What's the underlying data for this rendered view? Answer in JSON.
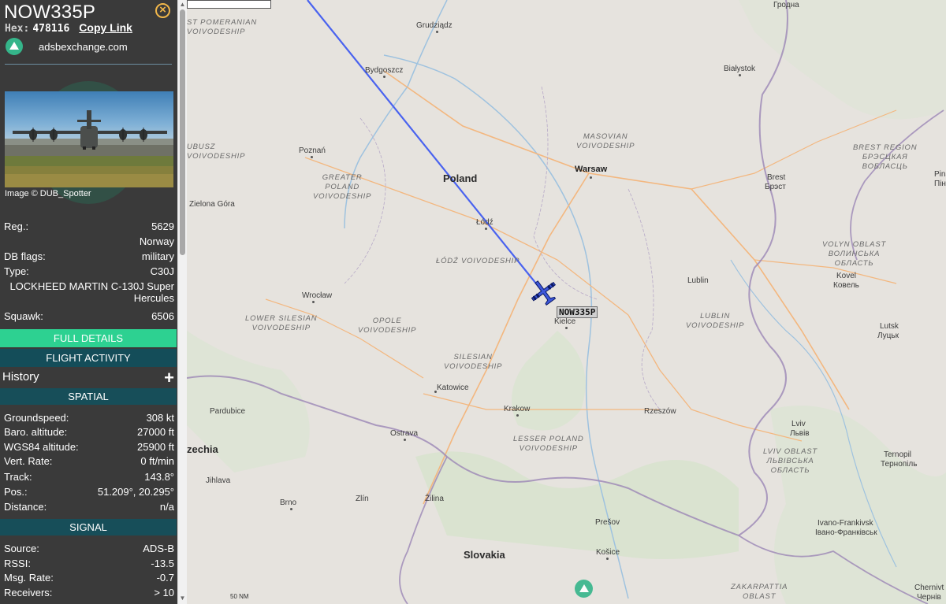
{
  "aircraft": {
    "callsign": "NOW335P",
    "hex_label": "Hex:",
    "hex": "478116",
    "copy_link": "Copy Link",
    "source_site": "adsbexchange.com",
    "photo_credit": "Image © DUB_Spotter"
  },
  "details": {
    "reg_label": "Reg.:",
    "reg": "5629",
    "country": "Norway",
    "db_flags_label": "DB flags:",
    "db_flags": "military",
    "type_label": "Type:",
    "type": "C30J",
    "type_desc": "LOCKHEED MARTIN C-130J Super Hercules",
    "squawk_label": "Squawk:",
    "squawk": "6506"
  },
  "buttons": {
    "full_details": "FULL DETAILS",
    "flight_activity": "FLIGHT ACTIVITY",
    "history": "History",
    "history_toggle": "+"
  },
  "spatial": {
    "title": "SPATIAL",
    "rows": [
      {
        "label": "Groundspeed:",
        "value": "308 kt"
      },
      {
        "label": "Baro. altitude:",
        "value": "27000 ft"
      },
      {
        "label": "WGS84 altitude:",
        "value": "25900 ft"
      },
      {
        "label": "Vert. Rate:",
        "value": "0 ft/min"
      },
      {
        "label": "Track:",
        "value": "143.8°"
      },
      {
        "label": "Pos.:",
        "value": "51.209°, 20.295°"
      },
      {
        "label": "Distance:",
        "value": "n/a"
      }
    ]
  },
  "signal": {
    "title": "SIGNAL",
    "rows": [
      {
        "label": "Source:",
        "value": "ADS-B"
      },
      {
        "label": "RSSI:",
        "value": "-13.5"
      },
      {
        "label": "Msg. Rate:",
        "value": "-0.7"
      },
      {
        "label": "Receivers:",
        "value": "> 10"
      }
    ]
  },
  "map": {
    "plane_label": "NOW335P",
    "scale_label": "50 NM",
    "track_color": "#4a63ef",
    "plane_color": "#3d57d9",
    "countries": {
      "poland": "Poland",
      "slovakia": "Slovakia",
      "czechia": "zechia"
    },
    "cities": {
      "grudziadz": "Grudziądz",
      "bydgoszcz": "Bydgoszcz",
      "bialystok": "Białystok",
      "grodno": "Гродна",
      "poznan": "Poznań",
      "warsaw": "Warsaw",
      "brest": "Brest",
      "brest_cyr": "Брэст",
      "pinsk": "Pins",
      "pinsk_cyr": "Пінс",
      "zielona_gora": "Zielona Góra",
      "lodz": "Łódź",
      "lublin": "Lublin",
      "kovel": "Kovel",
      "kovel_cyr": "Ковель",
      "wroclaw": "Wrocław",
      "kielce": "Kielce",
      "lutsk": "Lutsk",
      "lutsk_cyr": "Луцьк",
      "katowice": "Katowice",
      "krakow": "Krakow",
      "rzeszow": "Rzeszów",
      "pardubice": "Pardubice",
      "ostrava": "Ostrava",
      "lviv": "Lviv",
      "lviv_cyr": "Львів",
      "ternopil": "Ternopil",
      "ternopil_cyr": "Тернопіль",
      "jihlava": "Jihlava",
      "brno": "Brno",
      "zlin": "Zlín",
      "zilina": "Žilina",
      "presov": "Prešov",
      "kosice": "Košice",
      "ivano": "Ivano-Frankivsk",
      "ivano_cyr": "Івано-Франківськ",
      "chernivtsi": "Chernivt",
      "chernivtsi_cyr": "Чернів"
    },
    "regions": {
      "west_pomeranian": "ST POMERANIAN\nVOIVODESHIP",
      "lubusz": "UBUSZ\nVOIVODESHIP",
      "greater_poland": "GREATER\nPOLAND\nVOIVODESHIP",
      "masovian": "MASOVIAN\nVOIVODESHIP",
      "brest_region": "BREST REGION\nБРЭСЦКАЯ\nВОБЛАСЦЬ",
      "lodz_v": "ŁÓDŹ VOIVODESHIP",
      "volyn": "VOLYN OBLAST\nВОЛИНСЬКА\nОБЛАСТЬ",
      "lower_silesian": "LOWER SILESIAN\nVOIVODESHIP",
      "opole": "OPOLE\nVOIVODESHIP",
      "lublin_v": "LUBLIN\nVOIVODESHIP",
      "silesian": "SILESIAN\nVOIVODESHIP",
      "lesser_poland": "LESSER POLAND\nVOIVODESHIP",
      "lviv_oblast": "LVIV OBLAST\nЛЬВІВСЬКА\nОБЛАСТЬ",
      "zakarpattia": "ZAKARPATTIA\nOBLAST"
    }
  }
}
